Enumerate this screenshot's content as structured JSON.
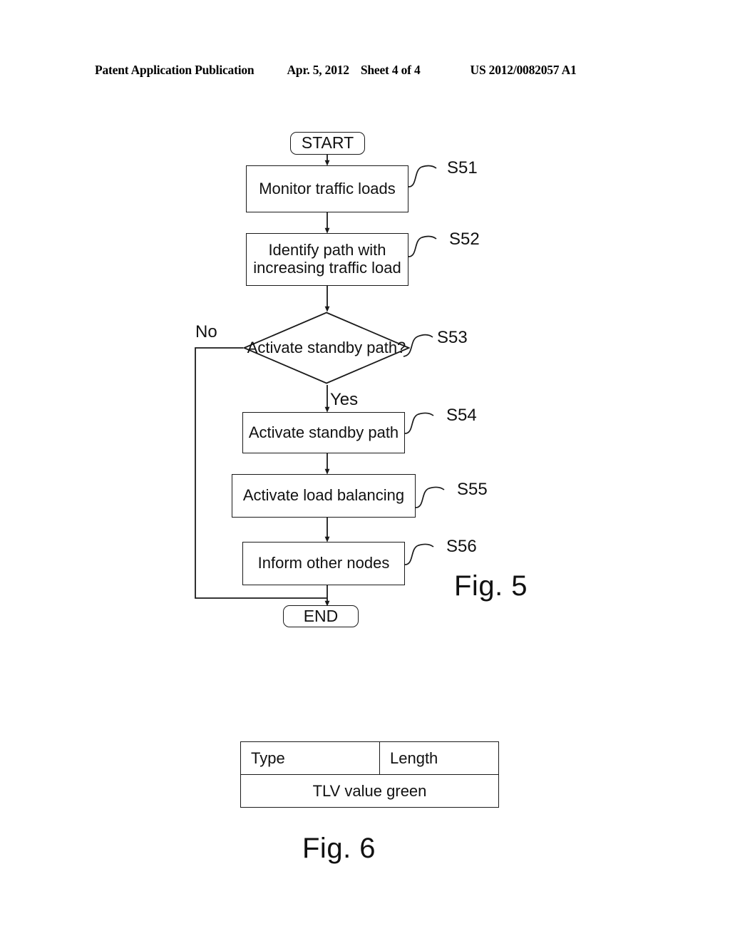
{
  "header": {
    "publication": "Patent Application Publication",
    "date": "Apr. 5, 2012",
    "sheet": "Sheet 4 of 4",
    "patent_number": "US 2012/0082057 A1"
  },
  "figure5": {
    "caption": "Fig. 5",
    "nodes": {
      "start": "START",
      "s51": "Monitor traffic loads",
      "s52": "Identify path with increasing traffic load",
      "s53": "Activate standby path?",
      "s54": "Activate standby path",
      "s55": "Activate load balancing",
      "s56": "Inform other nodes",
      "end": "END"
    },
    "step_labels": {
      "s51": "S51",
      "s52": "S52",
      "s53": "S53",
      "s54": "S54",
      "s55": "S55",
      "s56": "S56"
    },
    "branch_labels": {
      "no": "No",
      "yes": "Yes"
    }
  },
  "figure6": {
    "caption": "Fig. 6",
    "table": {
      "header_cells": [
        "Type",
        "Length"
      ],
      "value_row": "TLV value green"
    }
  },
  "colors": {
    "ink": "#111111",
    "line": "#1a1a1a",
    "background": "#ffffff"
  }
}
